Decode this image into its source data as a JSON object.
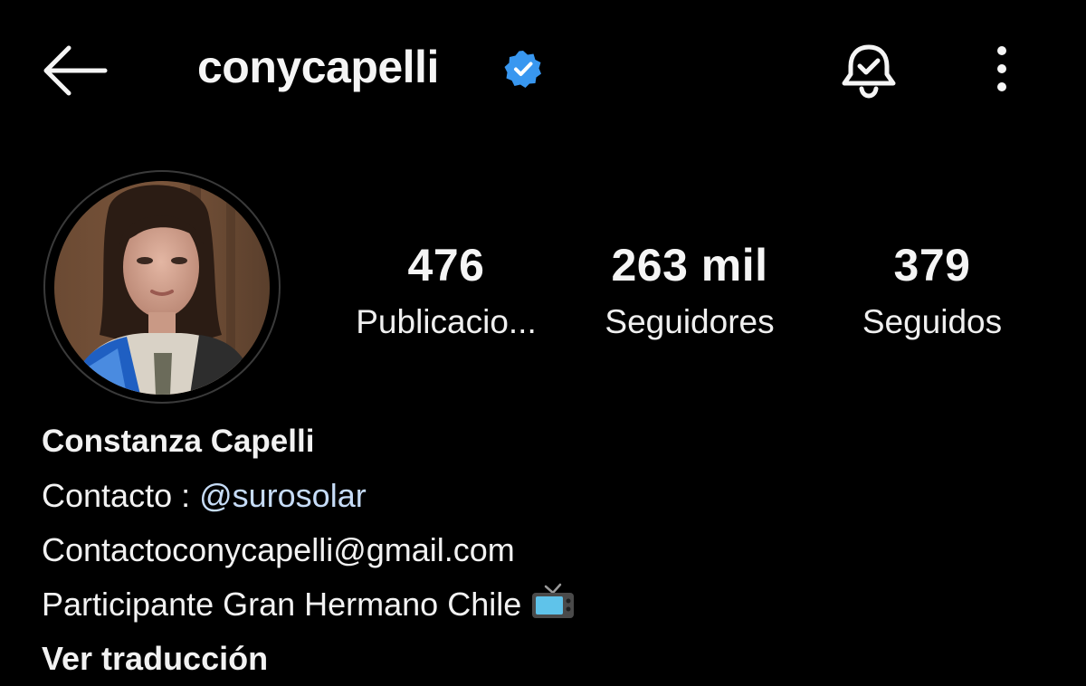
{
  "header": {
    "username": "conycapelli",
    "verified": true,
    "icons": {
      "back": "arrow-left-icon",
      "verified": "verified-badge-icon",
      "notifications": "bell-check-icon",
      "more": "more-vertical-icon"
    }
  },
  "profile": {
    "avatar_alt": "profile-photo",
    "stats": [
      {
        "value": "476",
        "label": "Publicacio..."
      },
      {
        "value": "263 mil",
        "label": "Seguidores"
      },
      {
        "value": "379",
        "label": "Seguidos"
      }
    ]
  },
  "bio": {
    "name": "Constanza Capelli",
    "contact_prefix": "Contacto : ",
    "contact_mention": "@surosolar",
    "email": "Contactoconycapelli@gmail.com",
    "description": "Participante Gran Hermano Chile",
    "description_icon": "television-icon",
    "translate_label": "Ver traducción"
  },
  "colors": {
    "background": "#000000",
    "text": "#f5f5f5",
    "verified": "#3897f0",
    "mention": "#c6dcf7"
  }
}
